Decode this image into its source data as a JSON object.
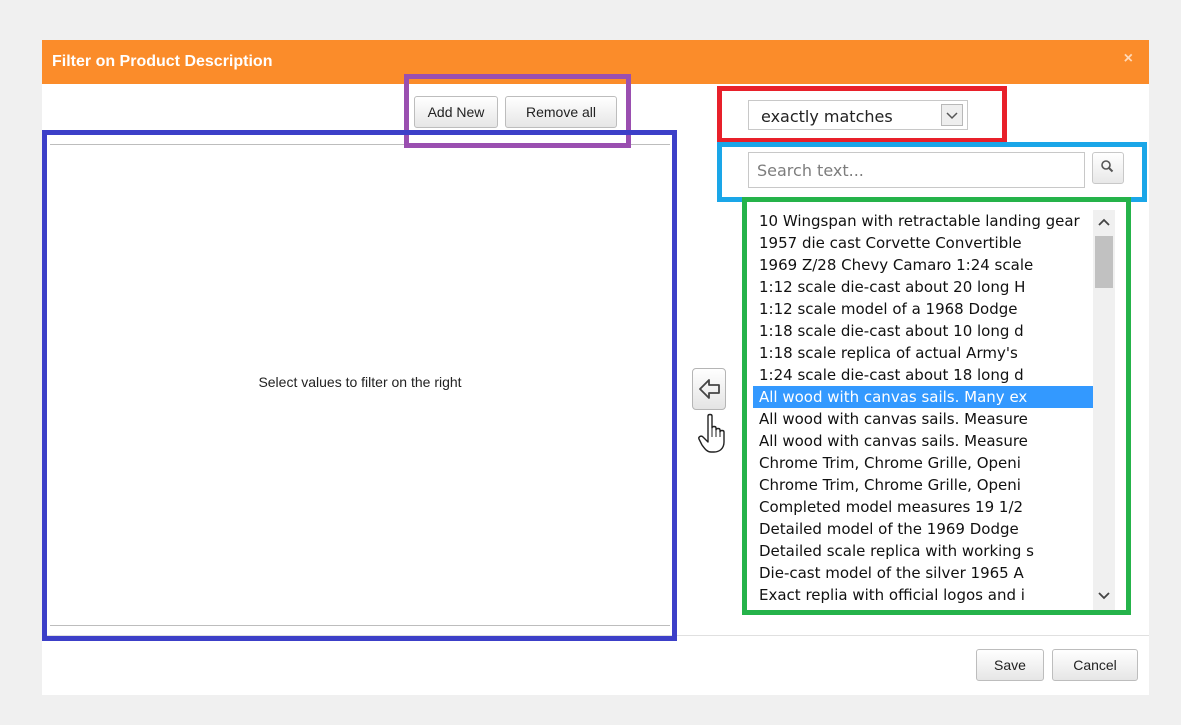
{
  "dialog": {
    "title": "Filter on Product Description",
    "close_symbol": "×"
  },
  "toolbar": {
    "add_new_label": "Add New",
    "remove_all_label": "Remove all"
  },
  "left_panel": {
    "placeholder": "Select values to filter on the right"
  },
  "match_select": {
    "selected": "exactly matches"
  },
  "search": {
    "placeholder": "Search text...",
    "value": ""
  },
  "values_list": {
    "selected_index": 8,
    "items": [
      "10 Wingspan with retractable landing gear",
      "1957 die cast Corvette Convertible",
      "1969 Z/28 Chevy Camaro 1:24 scale",
      "1:12 scale die-cast about 20 long H",
      "1:12 scale model of a 1968 Dodge",
      "1:18 scale die-cast about 10 long d",
      "1:18 scale replica of actual Army's",
      "1:24 scale die-cast about 18 long d",
      "All wood with canvas sails. Many ex",
      "All wood with canvas sails. Measure",
      "All wood with canvas sails. Measure",
      "Chrome Trim, Chrome Grille, Openi",
      "Chrome Trim, Chrome Grille, Openi",
      "Completed model measures 19 1/2",
      "Detailed model of the 1969 Dodge",
      "Detailed scale replica with working s",
      "Die-cast model of the silver 1965 A",
      "Exact replia with official logos and i"
    ]
  },
  "footer": {
    "save_label": "Save",
    "cancel_label": "Cancel"
  },
  "colors": {
    "titlebar": "#fb8c2a",
    "selection": "#3399ff",
    "annotation_blue": "#3c3fc8",
    "annotation_purple": "#9a4fb0",
    "annotation_red": "#e8202a",
    "annotation_cyan": "#1aa6e8",
    "annotation_green": "#25b34a"
  },
  "icons": {
    "search_button": "magnifier-icon",
    "transfer_button": "arrow-left-icon",
    "cursor": "hand-pointer-icon",
    "select_arrow": "chevron-down-icon"
  }
}
